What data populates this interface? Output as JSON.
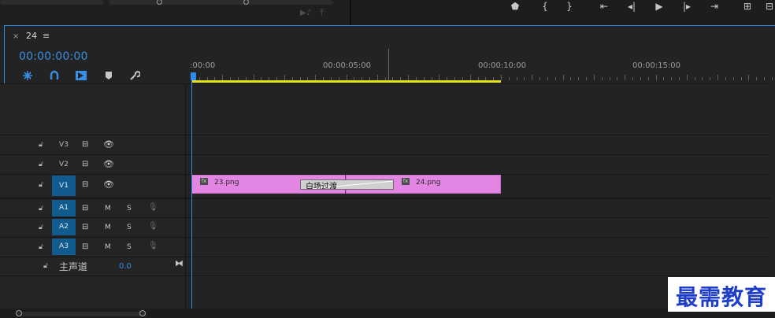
{
  "sequence_tab": {
    "close_symbol": "×",
    "title": "24",
    "menu_symbol": "≡"
  },
  "timecode": "00:00:00:00",
  "ruler": {
    "labels": [
      ":00:00",
      "00:00:05:00",
      "00:00:10:00",
      "00:00:15:00"
    ],
    "playhead_time_seconds": 0,
    "work_area_end_seconds": 10
  },
  "tracks": [
    {
      "id": "V3",
      "label": "V3",
      "kind": "video",
      "target_active": false
    },
    {
      "id": "V2",
      "label": "V2",
      "kind": "video",
      "target_active": false
    },
    {
      "id": "V1",
      "label": "V1",
      "kind": "video",
      "target_active": true
    },
    {
      "id": "A1",
      "label": "A1",
      "kind": "audio",
      "target_active": true,
      "mute": "M",
      "solo": "S"
    },
    {
      "id": "A2",
      "label": "A2",
      "kind": "audio",
      "target_active": true,
      "mute": "M",
      "solo": "S"
    },
    {
      "id": "A3",
      "label": "A3",
      "kind": "audio",
      "target_active": true,
      "mute": "M",
      "solo": "S"
    }
  ],
  "clips": [
    {
      "track": "V1",
      "name": "23.png",
      "fx": "fx"
    },
    {
      "track": "V1",
      "name": "24.png",
      "fx": "fx"
    }
  ],
  "transition": {
    "label": "白场过渡"
  },
  "master": {
    "label": "主声道",
    "value": "0.0"
  },
  "watermark": "最需教育",
  "colors": {
    "accent": "#2d8ceb",
    "clip": "#e385e3",
    "work_area": "#e4e11e",
    "target_active": "#115b8e",
    "watermark": "#1f3ec8"
  },
  "icons": {
    "toolbar_top": [
      "marker-icon",
      "in-point-icon",
      "out-point-icon",
      "go-to-in-icon",
      "step-back-icon",
      "play-icon",
      "step-forward-icon",
      "go-to-out-icon",
      "lift-icon",
      "extract-icon"
    ],
    "timeline_tools": [
      "snap-icon",
      "linked-selection-icon",
      "insert-overwrite-icon",
      "add-marker-icon",
      "wrench-icon"
    ]
  }
}
